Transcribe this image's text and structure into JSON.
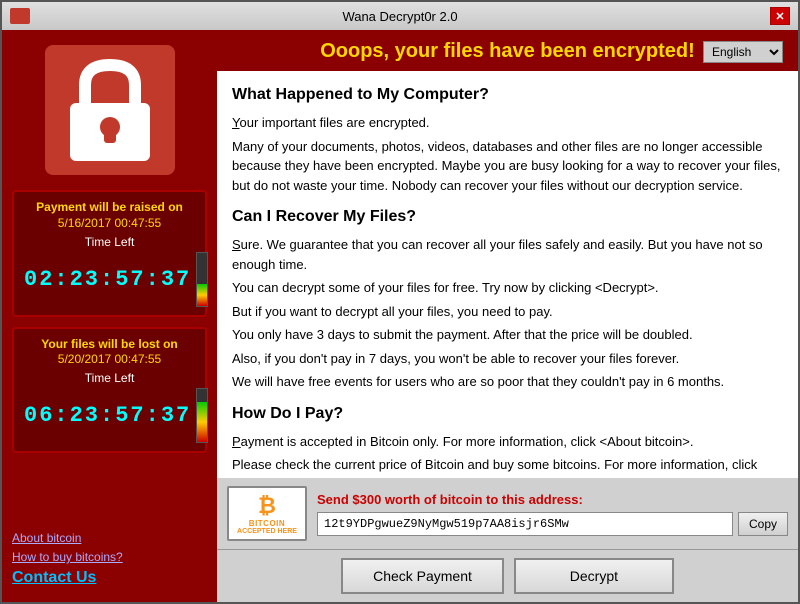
{
  "window": {
    "title": "Wana Decrypt0r 2.0",
    "close_button": "✕"
  },
  "header": {
    "title": "Ooops, your files have been encrypted!",
    "language_default": "English"
  },
  "left_panel": {
    "timer1": {
      "label": "Payment will be raised on",
      "date": "5/16/2017 00:47:55",
      "time_left_label": "Time Left",
      "time_display": "02:23:57:37",
      "bar_fill_pct": 40
    },
    "timer2": {
      "label": "Your files will be lost on",
      "date": "5/20/2017 00:47:55",
      "time_left_label": "Time Left",
      "time_display": "06:23:57:37",
      "bar_fill_pct": 75
    },
    "links": {
      "about_bitcoin": "About bitcoin",
      "how_to_buy": "How to buy bitcoins?",
      "contact_us": "Contact Us"
    }
  },
  "content": {
    "section1_title": "What Happened to My Computer?",
    "section1_body": "Your important files are encrypted.\nMany of your documents, photos, videos, databases and other files are no longer accessible because they have been encrypted. Maybe you are busy looking for a way to recover your files, but do not waste your time. Nobody can recover your files without our decryption service.",
    "section2_title": "Can I Recover My Files?",
    "section2_body": "Sure. We guarantee that you can recover all your files safely and easily. But you have not so enough time.\nYou can decrypt some of your files for free. Try now by clicking <Decrypt>.\nBut if you want to decrypt all your files, you need to pay.\nYou only have 3 days to submit the payment. After that the price will be doubled.\nAlso, if you don't pay in 7 days, you won't be able to recover your files forever.\nWe will have free events for users who are so poor that they couldn't pay in 6 months.",
    "section3_title": "How Do I Pay?",
    "section3_body": "Payment is accepted in Bitcoin only. For more information, click <About bitcoin>.\nPlease check the current price of Bitcoin and buy some bitcoins. For more information, click <How to buy bitcoins>.\nAnd send the correct amount to the address specified in this window.\nAfter your payment, click <Check Payment>. Best time to check: 9:00am - 11:00am GMT from Monday to Friday."
  },
  "bitcoin": {
    "symbol": "₿",
    "accepted_text": "bitcoin",
    "accepted_here": "ACCEPTED HERE",
    "send_label": "Send $300 worth of bitcoin to this address:",
    "address": "12t9YDPgwueZ9NyMgw519p7AA8isjr6SMw",
    "copy_button": "Copy"
  },
  "buttons": {
    "check_payment": "Check Payment",
    "decrypt": "Decrypt"
  }
}
